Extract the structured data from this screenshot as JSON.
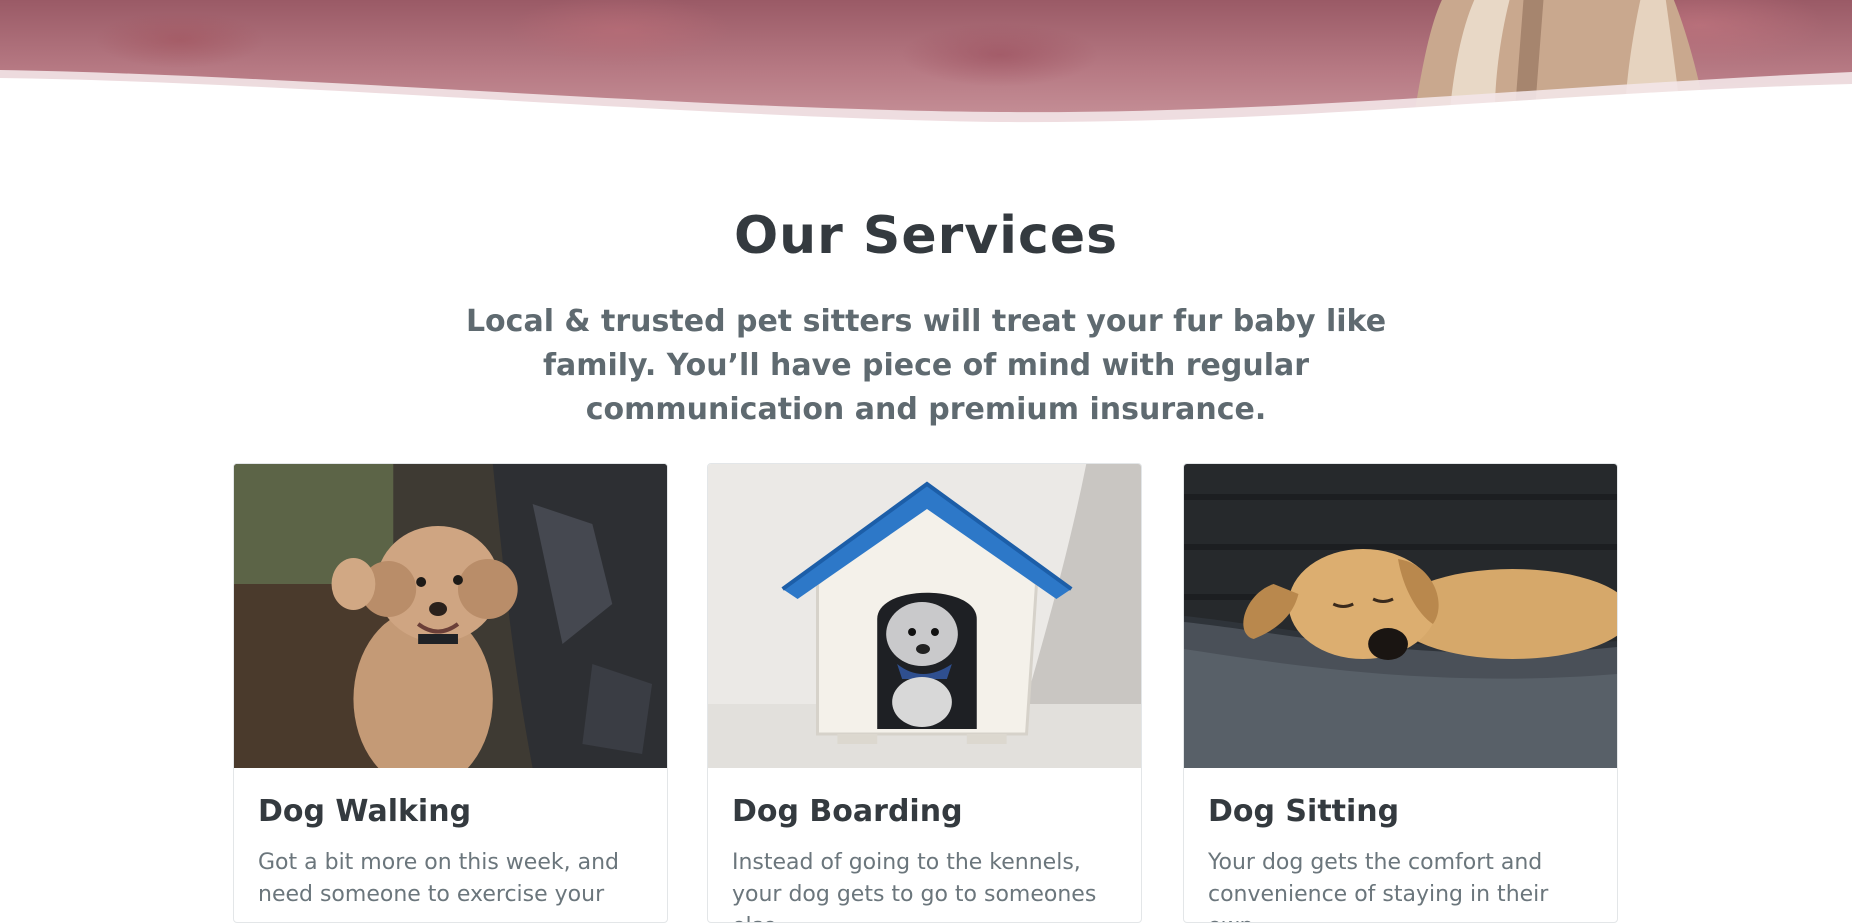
{
  "services": {
    "title": "Our Services",
    "intro": "Local & trusted pet sitters will treat your fur baby like family. You’ll have piece of mind with regular communication and premium insurance."
  },
  "cards": [
    {
      "title": "Dog Walking",
      "text": "Got a bit more on this week, and need someone to exercise your",
      "image_icon": "poodle-photo"
    },
    {
      "title": "Dog Boarding",
      "text": "Instead of going to the kennels, your dog gets to go to someones else,",
      "image_icon": "doghouse-photo"
    },
    {
      "title": "Dog Sitting",
      "text": "Your dog gets the comfort and convenience of staying in their own",
      "image_icon": "sleeping-dog-photo"
    }
  ],
  "colors": {
    "heading": "#343a3f",
    "intro": "#5f6a70",
    "body_text": "#6b767c",
    "card_border": "#e3e6e8"
  }
}
